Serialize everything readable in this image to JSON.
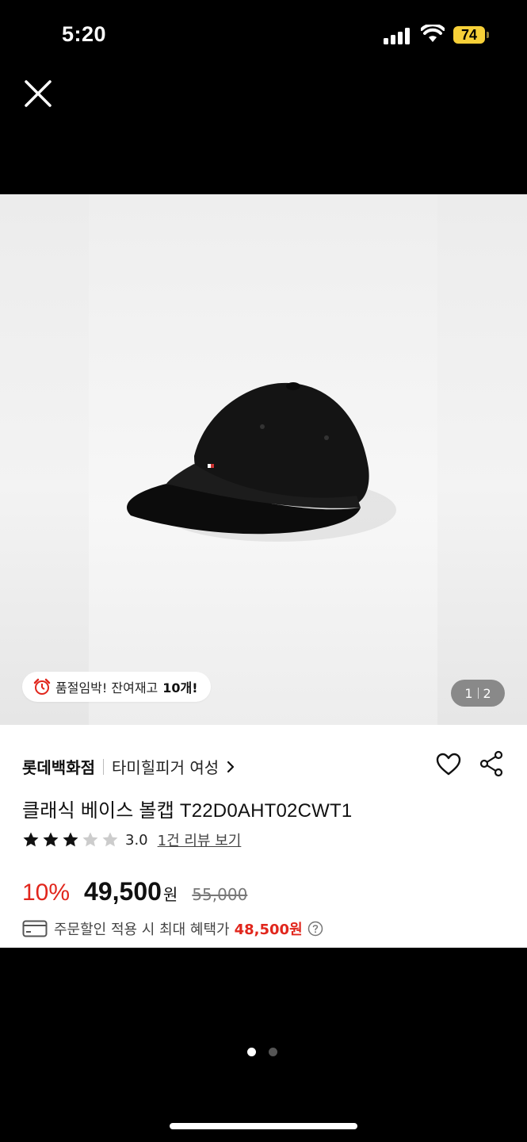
{
  "status_bar": {
    "time": "5:20",
    "battery": "74",
    "icons": [
      "cellular-signal-icon",
      "wifi-icon",
      "battery-icon"
    ]
  },
  "header": {
    "close_icon": "close-icon"
  },
  "gallery": {
    "image_subject": "black-baseball-cap",
    "stock_badge": {
      "icon": "alarm-clock-icon",
      "text": "품절임박! 잔여재고",
      "count": "10개!"
    },
    "page_indicator": {
      "current": "1",
      "total": "2"
    }
  },
  "product": {
    "brand": "롯데백화점",
    "seller": "타미힐피거 여성",
    "title": "클래식 베이스 볼캡 T22D0AHT02CWT1",
    "rating": {
      "stars_filled": 3,
      "stars_total": 5,
      "value": "3.0",
      "review_link": "1건 리뷰 보기"
    },
    "price": {
      "discount": "10%",
      "sale": "49,500",
      "currency": "원",
      "original": "55,000"
    },
    "benefit": {
      "text": "주문할인 적용 시 최대 혜택가",
      "price": "48,500원"
    }
  },
  "carousel": {
    "dots": 2,
    "active": 0
  },
  "colors": {
    "accent_red": "#e1261c",
    "badge_yellow": "#f7d038",
    "star_filled": "#111111",
    "star_empty": "#cccccc"
  }
}
